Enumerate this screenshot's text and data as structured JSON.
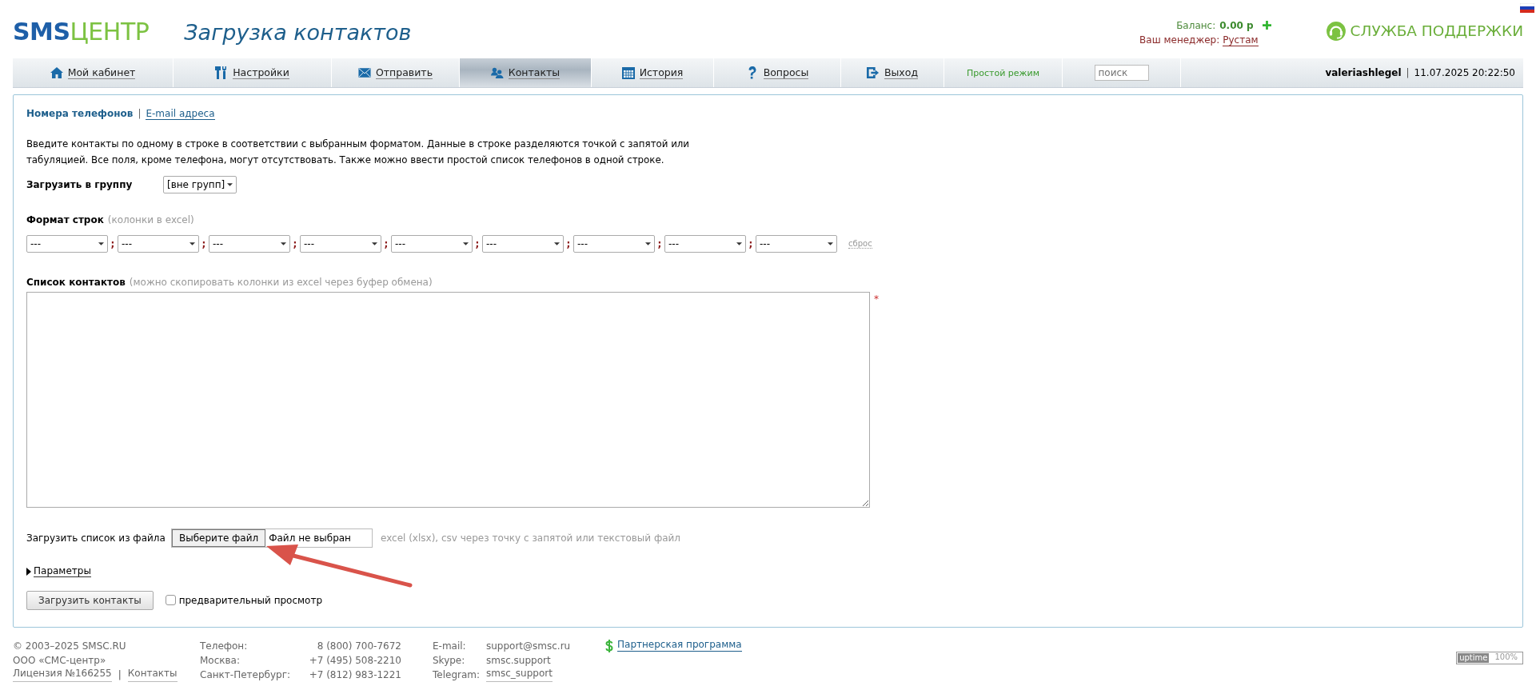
{
  "logo": {
    "first": "SMS",
    "second": "ЦЕНТР"
  },
  "page_title": "Загрузка контактов",
  "balance": {
    "label": "Баланс:",
    "value": "0.00 р"
  },
  "manager": {
    "label": "Ваш менеджер:",
    "name": "Рустам"
  },
  "support": "СЛУЖБА ПОДДЕРЖКИ",
  "nav": {
    "items": [
      {
        "label": "Мой кабинет",
        "selected": false
      },
      {
        "label": "Настройки",
        "selected": false
      },
      {
        "label": "Отправить",
        "selected": false
      },
      {
        "label": "Контакты",
        "selected": true
      },
      {
        "label": "История",
        "selected": false
      },
      {
        "label": "Вопросы",
        "selected": false
      },
      {
        "label": "Выход",
        "selected": false
      }
    ],
    "simple_mode": "Простой режим",
    "search": {
      "placeholder": "поиск"
    },
    "user": "valeriashlegel",
    "separator": "|",
    "datetime": "11.07.2025 20:22:50"
  },
  "tabs": [
    {
      "label": "Номера телефонов",
      "selected": true
    },
    {
      "label": "E-mail адреса",
      "selected": false
    }
  ],
  "tab_separator": "|",
  "intro": "Введите контакты по одному в строке в соответствии с выбранным форматом. Данные в строке разделяются точкой с запятой или табуляцией. Все поля, кроме телефона, могут отсутствовать. Также можно ввести простой список телефонов в одной строке.",
  "group": {
    "label": "Загрузить в группу",
    "value": "[вне групп]"
  },
  "format": {
    "label": "Формат строк",
    "hint": "(колонки в excel)",
    "columns": [
      {
        "value": "---"
      },
      {
        "value": "---"
      },
      {
        "value": "---"
      },
      {
        "value": "---"
      },
      {
        "value": "---"
      },
      {
        "value": "---"
      },
      {
        "value": "---"
      },
      {
        "value": "---"
      },
      {
        "value": "---"
      }
    ],
    "separators": [
      ";",
      ";",
      ";",
      ";",
      ";",
      ";",
      ";",
      ";"
    ],
    "reset": "сброс"
  },
  "contacts": {
    "label": "Список контактов",
    "hint": "(можно скопировать колонки из excel через буфер обмена)",
    "required": "*"
  },
  "file": {
    "label": "Загрузить список из файла",
    "button": "Выберите файл",
    "status": "Файл не выбран",
    "hint": "excel (xlsx), csv через точку с запятой или текстовый файл"
  },
  "params": {
    "label": "Параметры",
    "expanded": false
  },
  "submit": "Загрузить контакты",
  "preview": {
    "label": "предварительный просмотр",
    "checked": false
  },
  "footer": {
    "company": [
      "© 2003–2025 SMSC.RU",
      "ООО «СМС-центр»"
    ],
    "license": "Лицензия №166255",
    "links_separator": "|",
    "contacts_link": "Контакты",
    "phones": [
      {
        "city": "Телефон:",
        "number": "8 (800) 700-7672"
      },
      {
        "city": "Москва:",
        "number": "+7 (495) 508-2210"
      },
      {
        "city": "Санкт-Петербург:",
        "number": "+7 (812) 983-1221"
      }
    ],
    "channels": [
      {
        "label": "E-mail:",
        "value": "support@smsc.ru",
        "link": false
      },
      {
        "label": "Skype:",
        "value": "smsc.support",
        "link": false
      },
      {
        "label": "Telegram:",
        "value": "smsc_support",
        "link": true
      }
    ],
    "partner": "Партнерская программа"
  },
  "uptime": {
    "label": "uptime",
    "value": "100%"
  }
}
